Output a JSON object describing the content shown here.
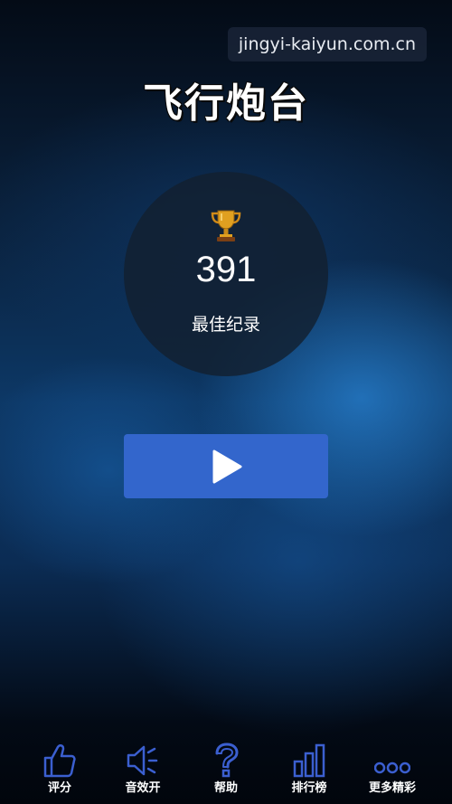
{
  "watermark": {
    "text": "jingyi-kaiyun.com.cn"
  },
  "game": {
    "title": "飞行炮台"
  },
  "score_panel": {
    "icon": "trophy-icon",
    "best_score": "391",
    "label": "最佳纪录"
  },
  "play_button": {
    "icon": "play-icon",
    "color": "#3366cc"
  },
  "bottom_nav": {
    "icon_color": "#3b5fd0",
    "items": [
      {
        "icon": "thumbs-up-icon",
        "label": "评分"
      },
      {
        "icon": "speaker-icon",
        "label": "音效开"
      },
      {
        "icon": "question-mark-icon",
        "label": "帮助"
      },
      {
        "icon": "bar-chart-icon",
        "label": "排行榜"
      },
      {
        "icon": "more-dots-icon",
        "label": "更多精彩"
      }
    ]
  }
}
